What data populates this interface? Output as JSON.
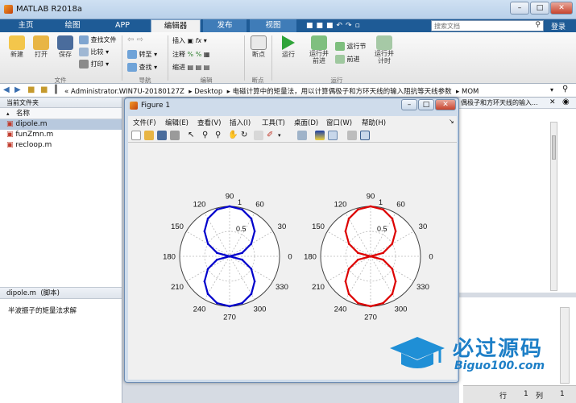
{
  "window": {
    "title": "MATLAB R2018a"
  },
  "tabs": [
    "主页",
    "绘图",
    "APP",
    "编辑器",
    "发布",
    "视图"
  ],
  "search": {
    "placeholder": "搜索文档"
  },
  "login": "登录",
  "ribbon": {
    "new": "新建",
    "open": "打开",
    "save": "保存",
    "find_files": "查找文件",
    "compare": "比较",
    "print": "打印",
    "goto": "转至",
    "find": "查找",
    "insert": "插入",
    "comment": "注释",
    "indent": "缩进",
    "breakpoints": "断点",
    "run": "运行",
    "run_advance": "运行并\n前进",
    "run_section": "运行节",
    "advance": "前进",
    "run_time": "运行并\n计时",
    "groups": {
      "file": "文件",
      "nav": "导航",
      "edit": "编辑",
      "bp": "断点",
      "run": "运行"
    }
  },
  "address": {
    "parts": [
      "Administrator.WIN7U-20180127Z",
      "Desktop",
      "电磁计算中的矩量法，用以计算偶极子和方环天线的输入阻抗等天线参数",
      "MOM"
    ]
  },
  "current_folder": {
    "title": "当前文件夹",
    "column": "名称",
    "files": [
      "dipole.m",
      "funZmn.m",
      "recloop.m"
    ],
    "details_title": "dipole.m  (脚本)",
    "details_desc": "半波振子的矩量法求解"
  },
  "editor_tab_partial": "偶极子和方环天线的输入...",
  "figure": {
    "title": "Figure 1",
    "menus": [
      "文件(F)",
      "编辑(E)",
      "查看(V)",
      "插入(I)",
      "工具(T)",
      "桌面(D)",
      "窗口(W)",
      "帮助(H)"
    ]
  },
  "status": {
    "row_label": "行",
    "row": "1",
    "col_label": "列",
    "col": "1"
  },
  "watermark": {
    "text": "必过源码",
    "url": "Biguo100.com"
  },
  "chart_data": [
    {
      "type": "polar",
      "color": "#0000cc",
      "angle_labels": [
        "90",
        "120",
        "150",
        "180",
        "210",
        "240",
        "270",
        "300",
        "330",
        "0",
        "30",
        "60"
      ],
      "radial_labels": [
        "0.5",
        "1"
      ],
      "rlim": [
        0,
        1
      ],
      "theta": [
        0,
        15,
        30,
        45,
        60,
        75,
        90,
        105,
        120,
        135,
        150,
        165,
        180,
        195,
        210,
        225,
        240,
        255,
        270,
        285,
        300,
        315,
        330,
        345,
        360
      ],
      "r": [
        0.0,
        0.26,
        0.5,
        0.71,
        0.87,
        0.97,
        1.0,
        0.97,
        0.87,
        0.71,
        0.5,
        0.26,
        0.0,
        0.26,
        0.5,
        0.71,
        0.87,
        0.97,
        1.0,
        0.97,
        0.87,
        0.71,
        0.5,
        0.26,
        0.0
      ]
    },
    {
      "type": "polar",
      "color": "#dd0000",
      "angle_labels": [
        "90",
        "120",
        "150",
        "180",
        "210",
        "240",
        "270",
        "300",
        "330",
        "0",
        "30",
        "60"
      ],
      "radial_labels": [
        "0.5",
        "1"
      ],
      "rlim": [
        0,
        1
      ],
      "theta": [
        0,
        15,
        30,
        45,
        60,
        75,
        90,
        105,
        120,
        135,
        150,
        165,
        180,
        195,
        210,
        225,
        240,
        255,
        270,
        285,
        300,
        315,
        330,
        345,
        360
      ],
      "r": [
        0.0,
        0.26,
        0.5,
        0.71,
        0.87,
        0.97,
        1.0,
        0.97,
        0.87,
        0.71,
        0.5,
        0.26,
        0.0,
        0.26,
        0.5,
        0.71,
        0.87,
        0.97,
        1.0,
        0.97,
        0.87,
        0.71,
        0.5,
        0.26,
        0.0
      ]
    }
  ]
}
